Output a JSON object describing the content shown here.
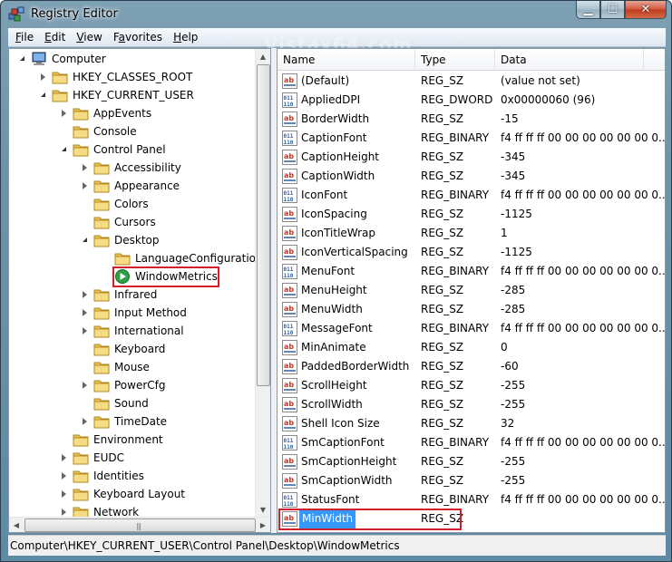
{
  "window": {
    "title": "Registry Editor"
  },
  "watermark": "Vistax64.com",
  "menu": [
    {
      "pre": "",
      "key": "F",
      "post": "ile"
    },
    {
      "pre": "",
      "key": "E",
      "post": "dit"
    },
    {
      "pre": "",
      "key": "V",
      "post": "iew"
    },
    {
      "pre": "F",
      "key": "a",
      "post": "vorites"
    },
    {
      "pre": "",
      "key": "H",
      "post": "elp"
    }
  ],
  "tree": [
    {
      "label": "Computer",
      "level": 0,
      "expander": "open",
      "icon": "computer-icon"
    },
    {
      "label": "HKEY_CLASSES_ROOT",
      "level": 1,
      "expander": "closed",
      "icon": "folder-icon"
    },
    {
      "label": "HKEY_CURRENT_USER",
      "level": 1,
      "expander": "open",
      "icon": "folder-icon"
    },
    {
      "label": "AppEvents",
      "level": 2,
      "expander": "closed",
      "icon": "folder-icon"
    },
    {
      "label": "Console",
      "level": 2,
      "expander": "none",
      "icon": "folder-icon"
    },
    {
      "label": "Control Panel",
      "level": 2,
      "expander": "open",
      "icon": "folder-icon"
    },
    {
      "label": "Accessibility",
      "level": 3,
      "expander": "closed",
      "icon": "folder-icon"
    },
    {
      "label": "Appearance",
      "level": 3,
      "expander": "closed",
      "icon": "folder-icon"
    },
    {
      "label": "Colors",
      "level": 3,
      "expander": "none",
      "icon": "folder-icon"
    },
    {
      "label": "Cursors",
      "level": 3,
      "expander": "none",
      "icon": "folder-icon"
    },
    {
      "label": "Desktop",
      "level": 3,
      "expander": "open",
      "icon": "folder-icon"
    },
    {
      "label": "LanguageConfiguration",
      "level": 4,
      "expander": "none",
      "icon": "folder-icon"
    },
    {
      "label": "WindowMetrics",
      "level": 4,
      "expander": "none",
      "icon": "play-icon",
      "highlight": true
    },
    {
      "label": "Infrared",
      "level": 3,
      "expander": "closed",
      "icon": "folder-icon"
    },
    {
      "label": "Input Method",
      "level": 3,
      "expander": "closed",
      "icon": "folder-icon"
    },
    {
      "label": "International",
      "level": 3,
      "expander": "closed",
      "icon": "folder-icon"
    },
    {
      "label": "Keyboard",
      "level": 3,
      "expander": "none",
      "icon": "folder-icon"
    },
    {
      "label": "Mouse",
      "level": 3,
      "expander": "none",
      "icon": "folder-icon"
    },
    {
      "label": "PowerCfg",
      "level": 3,
      "expander": "closed",
      "icon": "folder-icon"
    },
    {
      "label": "Sound",
      "level": 3,
      "expander": "none",
      "icon": "folder-icon"
    },
    {
      "label": "TimeDate",
      "level": 3,
      "expander": "closed",
      "icon": "folder-icon"
    },
    {
      "label": "Environment",
      "level": 2,
      "expander": "none",
      "icon": "folder-icon"
    },
    {
      "label": "EUDC",
      "level": 2,
      "expander": "closed",
      "icon": "folder-icon"
    },
    {
      "label": "Identities",
      "level": 2,
      "expander": "closed",
      "icon": "folder-icon"
    },
    {
      "label": "Keyboard Layout",
      "level": 2,
      "expander": "closed",
      "icon": "folder-icon"
    },
    {
      "label": "Network",
      "level": 2,
      "expander": "closed",
      "icon": "folder-icon"
    }
  ],
  "columns": {
    "name": "Name",
    "type": "Type",
    "data": "Data"
  },
  "values": [
    {
      "name": "(Default)",
      "type": "REG_SZ",
      "data": "(value not set)",
      "kind": "sz"
    },
    {
      "name": "AppliedDPI",
      "type": "REG_DWORD",
      "data": "0x00000060 (96)",
      "kind": "bin"
    },
    {
      "name": "BorderWidth",
      "type": "REG_SZ",
      "data": "-15",
      "kind": "sz"
    },
    {
      "name": "CaptionFont",
      "type": "REG_BINARY",
      "data": "f4 ff ff ff 00 00 00 00 00 00 0...",
      "kind": "bin"
    },
    {
      "name": "CaptionHeight",
      "type": "REG_SZ",
      "data": "-345",
      "kind": "sz"
    },
    {
      "name": "CaptionWidth",
      "type": "REG_SZ",
      "data": "-345",
      "kind": "sz"
    },
    {
      "name": "IconFont",
      "type": "REG_BINARY",
      "data": "f4 ff ff ff 00 00 00 00 00 00 0...",
      "kind": "bin"
    },
    {
      "name": "IconSpacing",
      "type": "REG_SZ",
      "data": "-1125",
      "kind": "sz"
    },
    {
      "name": "IconTitleWrap",
      "type": "REG_SZ",
      "data": "1",
      "kind": "sz"
    },
    {
      "name": "IconVerticalSpacing",
      "type": "REG_SZ",
      "data": "-1125",
      "kind": "sz"
    },
    {
      "name": "MenuFont",
      "type": "REG_BINARY",
      "data": "f4 ff ff ff 00 00 00 00 00 00 0...",
      "kind": "bin"
    },
    {
      "name": "MenuHeight",
      "type": "REG_SZ",
      "data": "-285",
      "kind": "sz"
    },
    {
      "name": "MenuWidth",
      "type": "REG_SZ",
      "data": "-285",
      "kind": "sz"
    },
    {
      "name": "MessageFont",
      "type": "REG_BINARY",
      "data": "f4 ff ff ff 00 00 00 00 00 00 0...",
      "kind": "bin"
    },
    {
      "name": "MinAnimate",
      "type": "REG_SZ",
      "data": "0",
      "kind": "sz"
    },
    {
      "name": "PaddedBorderWidth",
      "type": "REG_SZ",
      "data": "-60",
      "kind": "sz"
    },
    {
      "name": "ScrollHeight",
      "type": "REG_SZ",
      "data": "-255",
      "kind": "sz"
    },
    {
      "name": "ScrollWidth",
      "type": "REG_SZ",
      "data": "-255",
      "kind": "sz"
    },
    {
      "name": "Shell Icon Size",
      "type": "REG_SZ",
      "data": "32",
      "kind": "sz"
    },
    {
      "name": "SmCaptionFont",
      "type": "REG_BINARY",
      "data": "f4 ff ff ff 00 00 00 00 00 00 0...",
      "kind": "bin"
    },
    {
      "name": "SmCaptionHeight",
      "type": "REG_SZ",
      "data": "-255",
      "kind": "sz"
    },
    {
      "name": "SmCaptionWidth",
      "type": "REG_SZ",
      "data": "-255",
      "kind": "sz"
    },
    {
      "name": "StatusFont",
      "type": "REG_BINARY",
      "data": "f4 ff ff ff 00 00 00 00 00 00 0...",
      "kind": "bin"
    },
    {
      "name": "MinWidth",
      "type": "REG_SZ",
      "data": "",
      "kind": "sz",
      "selected": true,
      "highlight": true
    }
  ],
  "status": {
    "path": "Computer\\HKEY_CURRENT_USER\\Control Panel\\Desktop\\WindowMetrics"
  },
  "colors": {
    "selection": "#3399ff",
    "highlight_border": "#d21f2b"
  }
}
